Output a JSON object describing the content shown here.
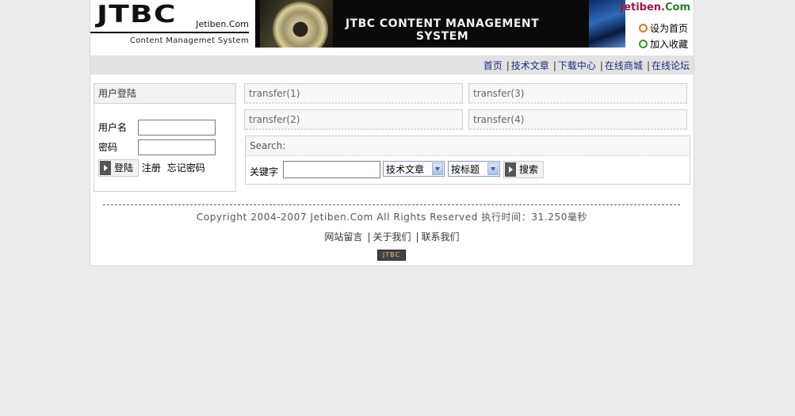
{
  "header": {
    "logo_text": "JTBC",
    "logo_site": "Jetiben.Com",
    "logo_sub": "Content Managemet System",
    "banner_title": "JTBC CONTENT MANAGEMENT SYSTEM",
    "brand_part1": "Jetiben.",
    "brand_part2": "Com",
    "set_home": "设为首页",
    "add_fav": "加入收藏",
    "colors": {
      "brand1": "#a0144e",
      "brand2": "#2b7d2b"
    }
  },
  "nav": {
    "items": [
      "首页",
      "技术文章",
      "下载中心",
      "在线商城",
      "在线论坛"
    ]
  },
  "login": {
    "title": "用户登陆",
    "username_label": "用户名",
    "password_label": "密码",
    "username_value": "",
    "password_value": "",
    "login_button": "登陆",
    "register_link": "注册",
    "forgot_link": "忘记密码"
  },
  "transfers": [
    "transfer(1)",
    "transfer(3)",
    "transfer(2)",
    "transfer(4)"
  ],
  "search": {
    "title": "Search:",
    "keyword_label": "关键字",
    "keyword_value": "",
    "category_selected": "技术文章",
    "field_selected": "按标题",
    "search_button": "搜索"
  },
  "footer": {
    "copyright": "Copyright 2004-2007 Jetiben.Com All Rights Reserved 执行时间：31.250毫秒",
    "links": [
      "网站留言",
      "关于我们",
      "联系我们"
    ],
    "badge": "JTBC"
  }
}
